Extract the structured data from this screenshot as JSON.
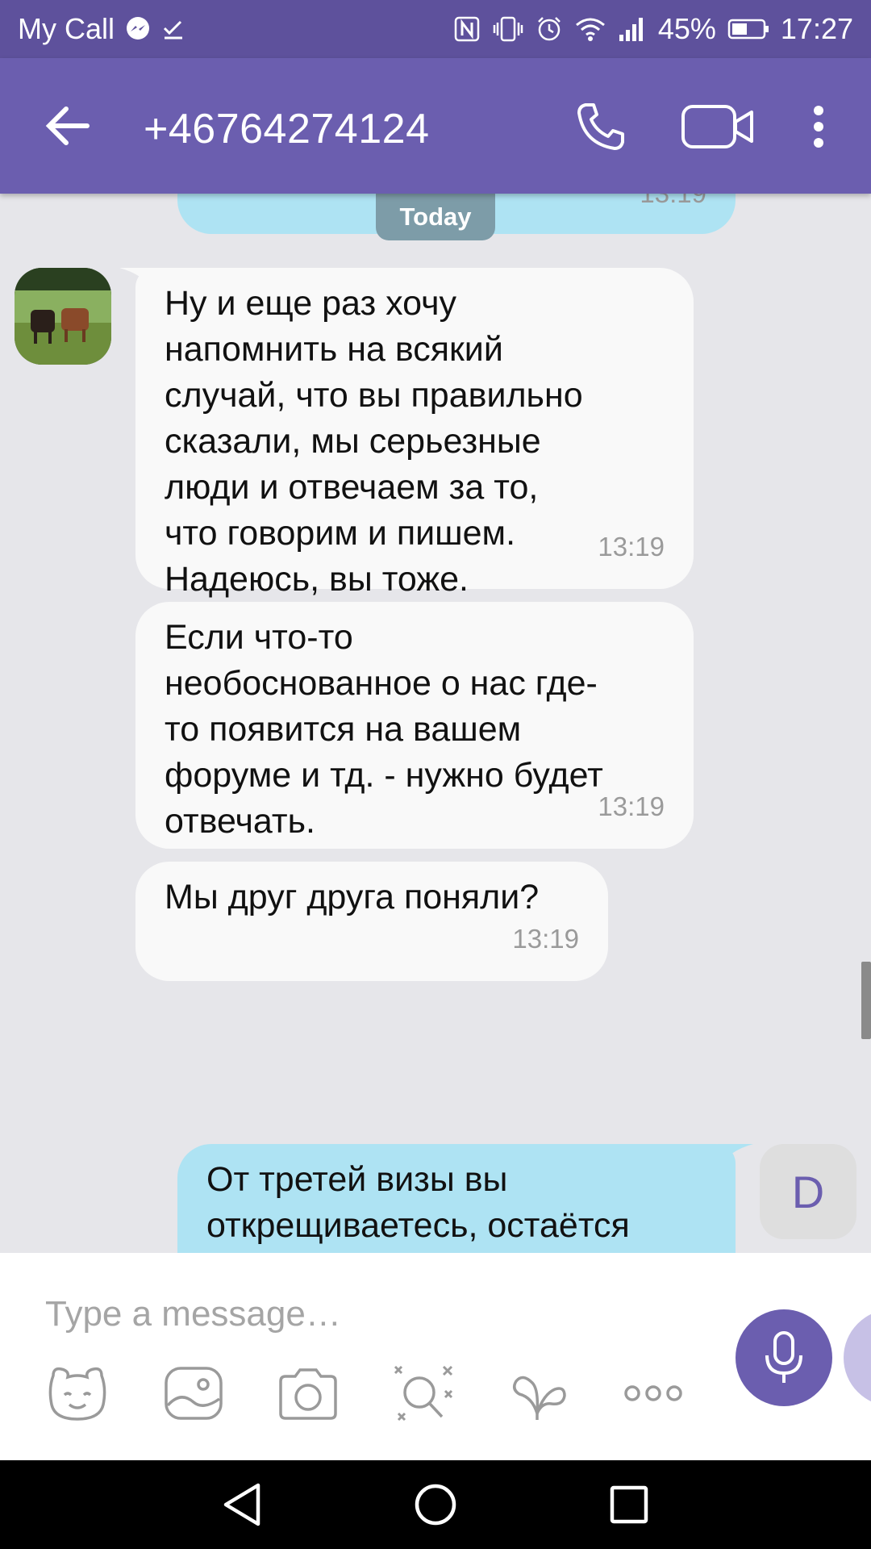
{
  "status_bar": {
    "app_name": "My Call",
    "battery_percent": "45%",
    "time": "17:27"
  },
  "header": {
    "contact": "+46764274124"
  },
  "chat": {
    "date_label": "Today",
    "partial_top_time": "13:19",
    "messages": [
      {
        "direction": "incoming",
        "text": "Ну и еще раз хочу\nнапомнить на всякий\nслучай, что вы правильно\nсказали, мы серьезные\nлюди и отвечаем за то,\nчто говорим и пишем.\nНадеюсь, вы тоже.",
        "time": "13:19"
      },
      {
        "direction": "incoming",
        "text": "Если что-то\nнеобоснованное о нас где-\nто появится на вашем\nфоруме и тд. - нужно будет\nотвечать.",
        "time": "13:19"
      },
      {
        "direction": "incoming",
        "text": "Мы друг друга поняли?",
        "time": "13:19"
      },
      {
        "direction": "outgoing",
        "text": "От третей визы вы\nоткрещиваетесь, остаётся"
      }
    ],
    "my_avatar_letter": "D"
  },
  "composer": {
    "placeholder": "Type a message…"
  },
  "icons": {
    "back": "arrow-left-icon",
    "call": "phone-icon",
    "video": "video-camera-icon",
    "menu": "more-vertical-icon",
    "sticker": "sticker-bear-icon",
    "gallery": "gallery-icon",
    "camera": "camera-icon",
    "doodle": "doodle-icon",
    "gif": "gif-icon",
    "more": "more-horizontal-icon",
    "mic": "microphone-icon"
  },
  "colors": {
    "status_bar": "#5e519c",
    "app_bar": "#6b5eaf",
    "incoming_bubble": "#f9f9f9",
    "outgoing_bubble": "#aee3f3",
    "chat_background": "#e6e6ea"
  }
}
